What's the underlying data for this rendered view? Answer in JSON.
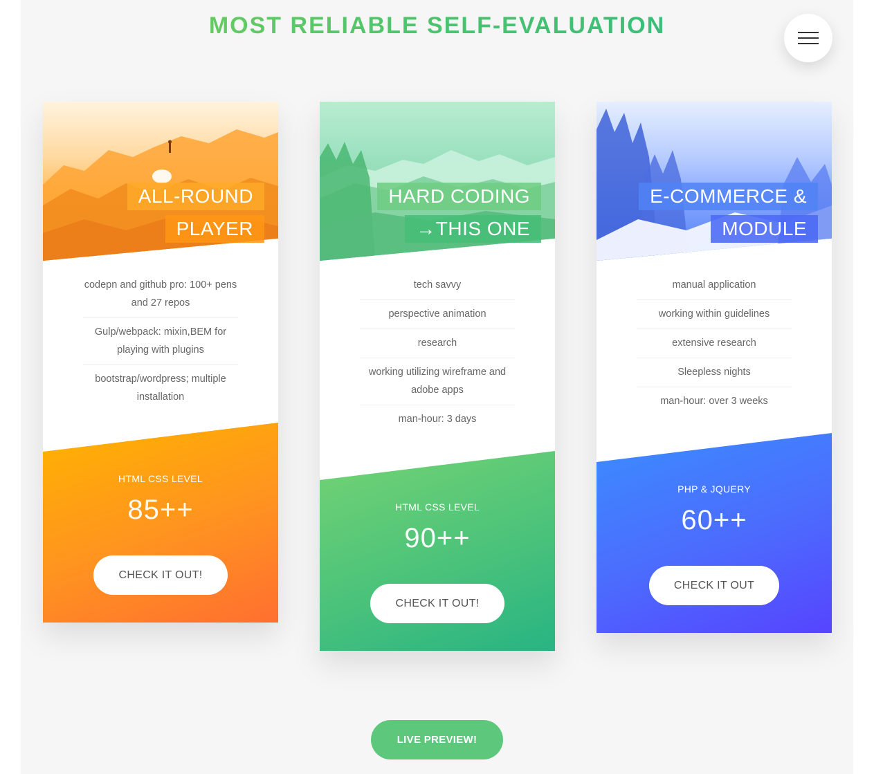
{
  "header": {
    "headline": "MOST RELIABLE SELF-EVALUATION",
    "menu_icon": "hamburger-menu-icon"
  },
  "cards": [
    {
      "title_line1": "ALL-ROUND",
      "title_line2": "PLAYER",
      "features": [
        "codepn and github pro: 100+ pens and 27 repos",
        "Gulp/webpack: mixin,BEM for playing with plugins",
        "bootstrap/wordpress; multiple installation"
      ],
      "level_label": "HTML CSS LEVEL",
      "level_value": "85++",
      "cta_label": "CHECK IT OUT!",
      "accent_colors": [
        "#ffb300",
        "#ff7a2e"
      ]
    },
    {
      "title_line1": "HARD CODING",
      "title_line2": "→THIS ONE",
      "features": [
        "tech savvy",
        "perspective animation",
        "research",
        "working utilizing wireframe and adobe apps",
        "man-hour: 3 days"
      ],
      "level_label": "HTML CSS LEVEL",
      "level_value": "90++",
      "cta_label": "CHECK IT OUT!",
      "accent_colors": [
        "#72d275",
        "#2db782"
      ]
    },
    {
      "title_line1": "E-COMMERCE &",
      "title_line2": "MODULE",
      "features": [
        "manual application",
        "working within guidelines",
        "extensive research",
        "Sleepless nights",
        "man-hour: over 3 weeks"
      ],
      "level_label": "PHP & JQUERY",
      "level_value": "60++",
      "cta_label": "CHECK IT OUT",
      "accent_colors": [
        "#3a8cff",
        "#5647ff"
      ]
    }
  ],
  "footer": {
    "live_preview_label": "LIVE PREVIEW!"
  }
}
